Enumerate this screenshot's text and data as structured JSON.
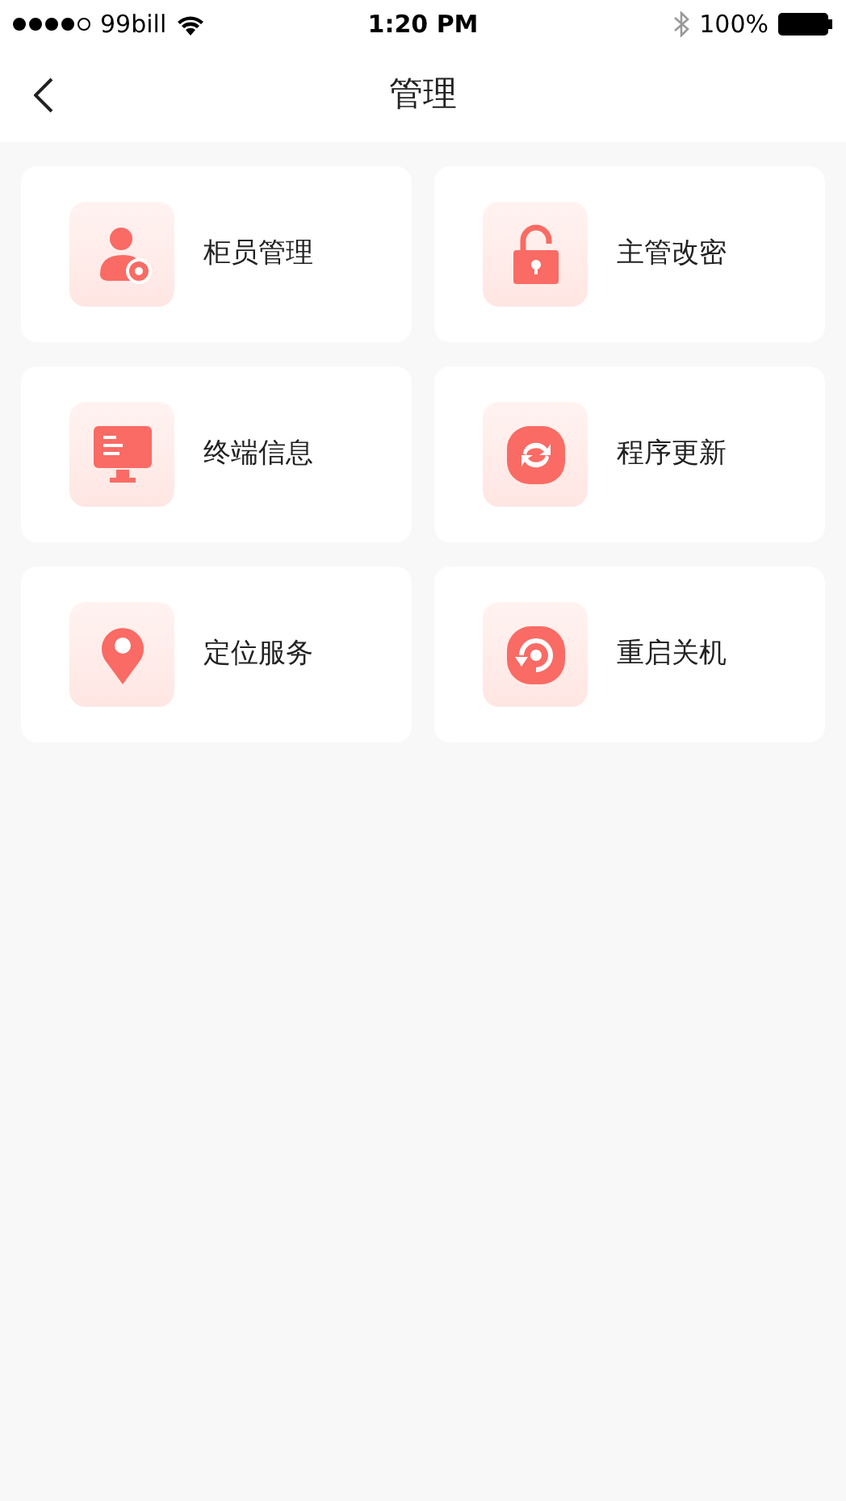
{
  "status_bar": {
    "carrier": "99bill",
    "time": "1:20 PM",
    "battery": "100%"
  },
  "nav": {
    "title": "管理"
  },
  "items": [
    {
      "kind": "staff",
      "label": "柜员管理"
    },
    {
      "kind": "lock",
      "label": "主管改密"
    },
    {
      "kind": "monitor",
      "label": "终端信息"
    },
    {
      "kind": "update",
      "label": "程序更新"
    },
    {
      "kind": "location",
      "label": "定位服务"
    },
    {
      "kind": "restart",
      "label": "重启关机"
    }
  ]
}
